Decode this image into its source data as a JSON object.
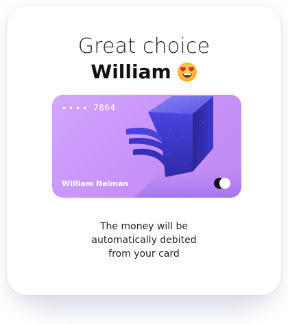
{
  "dialog": {
    "title_line1": "Great choice",
    "title_name": "William",
    "title_emoji": "heart-eyes-emoji",
    "message_lines": [
      "The money will be",
      "automatically debited",
      "from your card"
    ]
  },
  "card": {
    "masked_dots": "••••",
    "last_digits": "7864",
    "holder_name": "William Neiman",
    "logo_icon": "card-brand-logo-icon",
    "colors": {
      "card_bg": "#c993f7",
      "accent_blue": "#3b36d8",
      "accent_dark": "#2a2598"
    }
  }
}
